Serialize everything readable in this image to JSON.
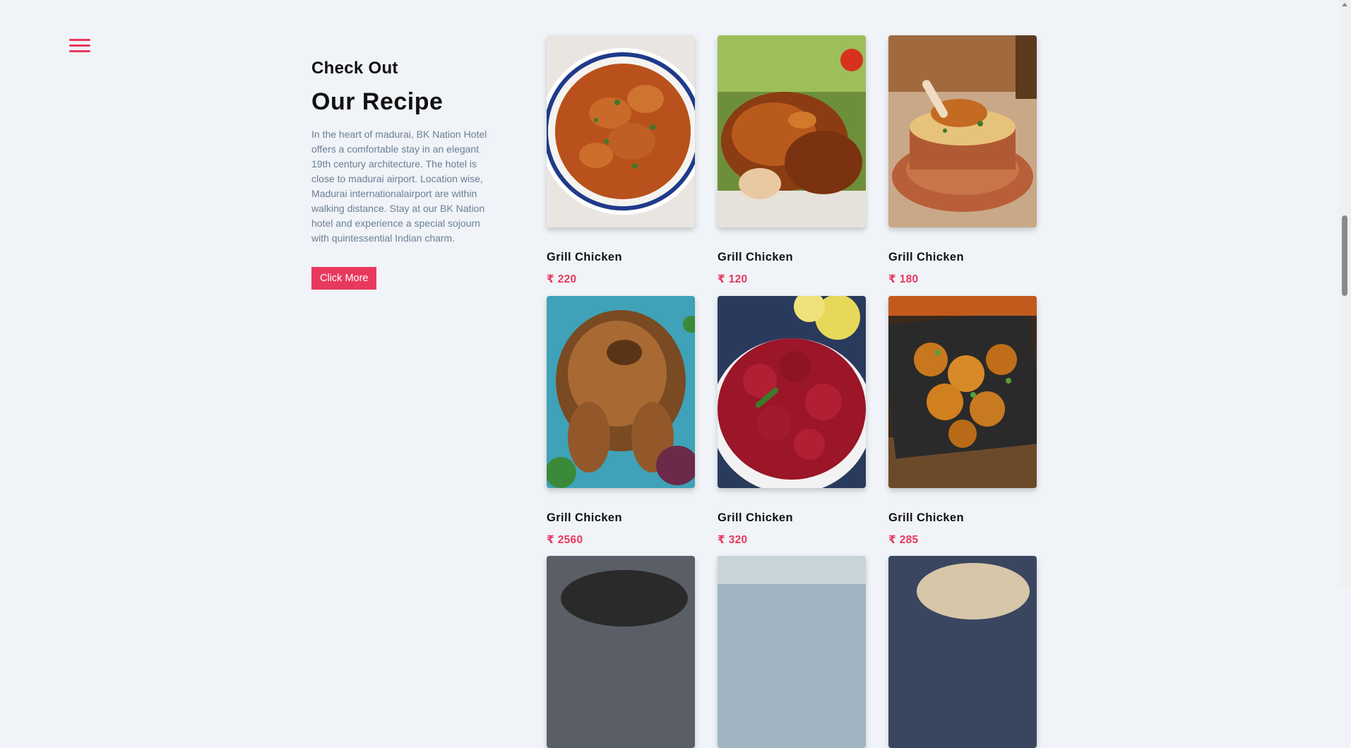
{
  "nav": {
    "menu_icon": "hamburger-icon"
  },
  "intro": {
    "kicker": "Check Out",
    "title": "Our Recipe",
    "description": "In the heart of madurai, BK Nation Hotel offers a comfortable stay in an elegant 19th century architecture. The hotel is close to madurai airport. Location wise, Madurai internationalairport are within walking distance. Stay at our BK Nation hotel and experience a special sojourn with quintessential Indian charm.",
    "button_label": "Click More"
  },
  "recipes": [
    {
      "name": "Grill Chicken",
      "price": "₹ 220"
    },
    {
      "name": "Grill Chicken",
      "price": "₹ 120"
    },
    {
      "name": "Grill Chicken",
      "price": "₹ 180"
    },
    {
      "name": "Grill Chicken",
      "price": "₹ 2560"
    },
    {
      "name": "Grill Chicken",
      "price": "₹ 320"
    },
    {
      "name": "Grill Chicken",
      "price": "₹ 285"
    }
  ],
  "colors": {
    "accent": "#e8385e",
    "background": "#f0f3f7",
    "text_muted": "#6b7f95"
  }
}
